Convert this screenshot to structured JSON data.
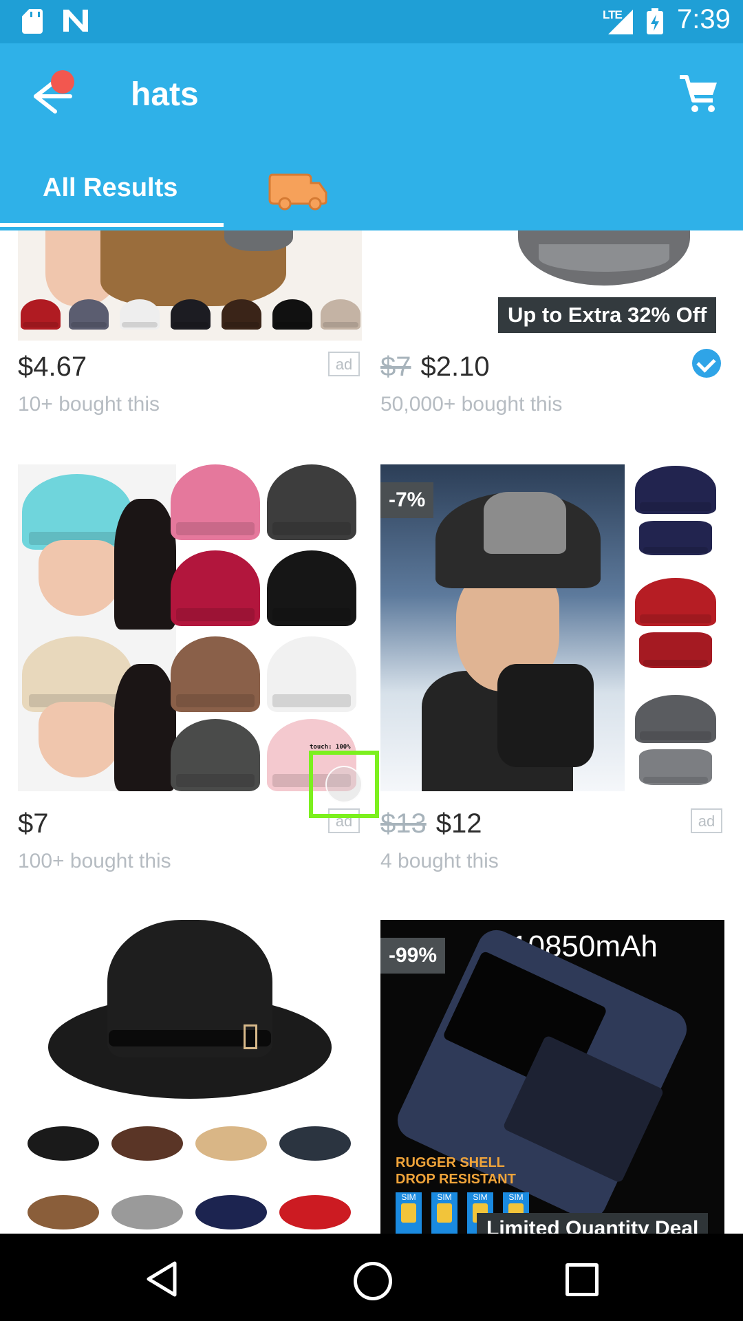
{
  "status_bar": {
    "network": "LTE",
    "time": "7:39"
  },
  "app_bar": {
    "title": "hats",
    "tabs": [
      {
        "label": "All Results"
      }
    ]
  },
  "products": [
    {
      "price": "$4.67",
      "old_price": "",
      "sold": "10+ bought this",
      "ad": "ad",
      "promo": "",
      "discount": ""
    },
    {
      "price": "$2.10",
      "old_price": "$7",
      "sold": "50,000+ bought this",
      "ad": "",
      "promo": "Up to Extra 32% Off",
      "discount": "",
      "verified": true
    },
    {
      "price": "$7",
      "old_price": "",
      "sold": "100+ bought this",
      "ad": "ad",
      "promo": "",
      "discount": ""
    },
    {
      "price": "$12",
      "old_price": "$13",
      "sold": "4 bought this",
      "ad": "ad",
      "promo": "",
      "discount": "-7%"
    },
    {
      "price": "",
      "old_price": "",
      "sold": "",
      "ad": "",
      "promo": "",
      "discount": ""
    },
    {
      "price": "",
      "old_price": "",
      "sold": "",
      "ad": "",
      "promo": "Limited Quantity Deal",
      "discount": "-99%",
      "image_text": {
        "capacity": "10850mAh",
        "line1": "RUGGER SHELL",
        "line2": "DROP RESISTANT",
        "sim": "SIM"
      }
    }
  ],
  "touch_overlay": {
    "label": "touch: 100%"
  },
  "colors": {
    "status_bar": "#1f9fd6",
    "app_bar": "#2fb1e8",
    "notification_dot": "#f2574f",
    "verified": "#2fa4e7",
    "touch_box": "#7cf01e"
  }
}
